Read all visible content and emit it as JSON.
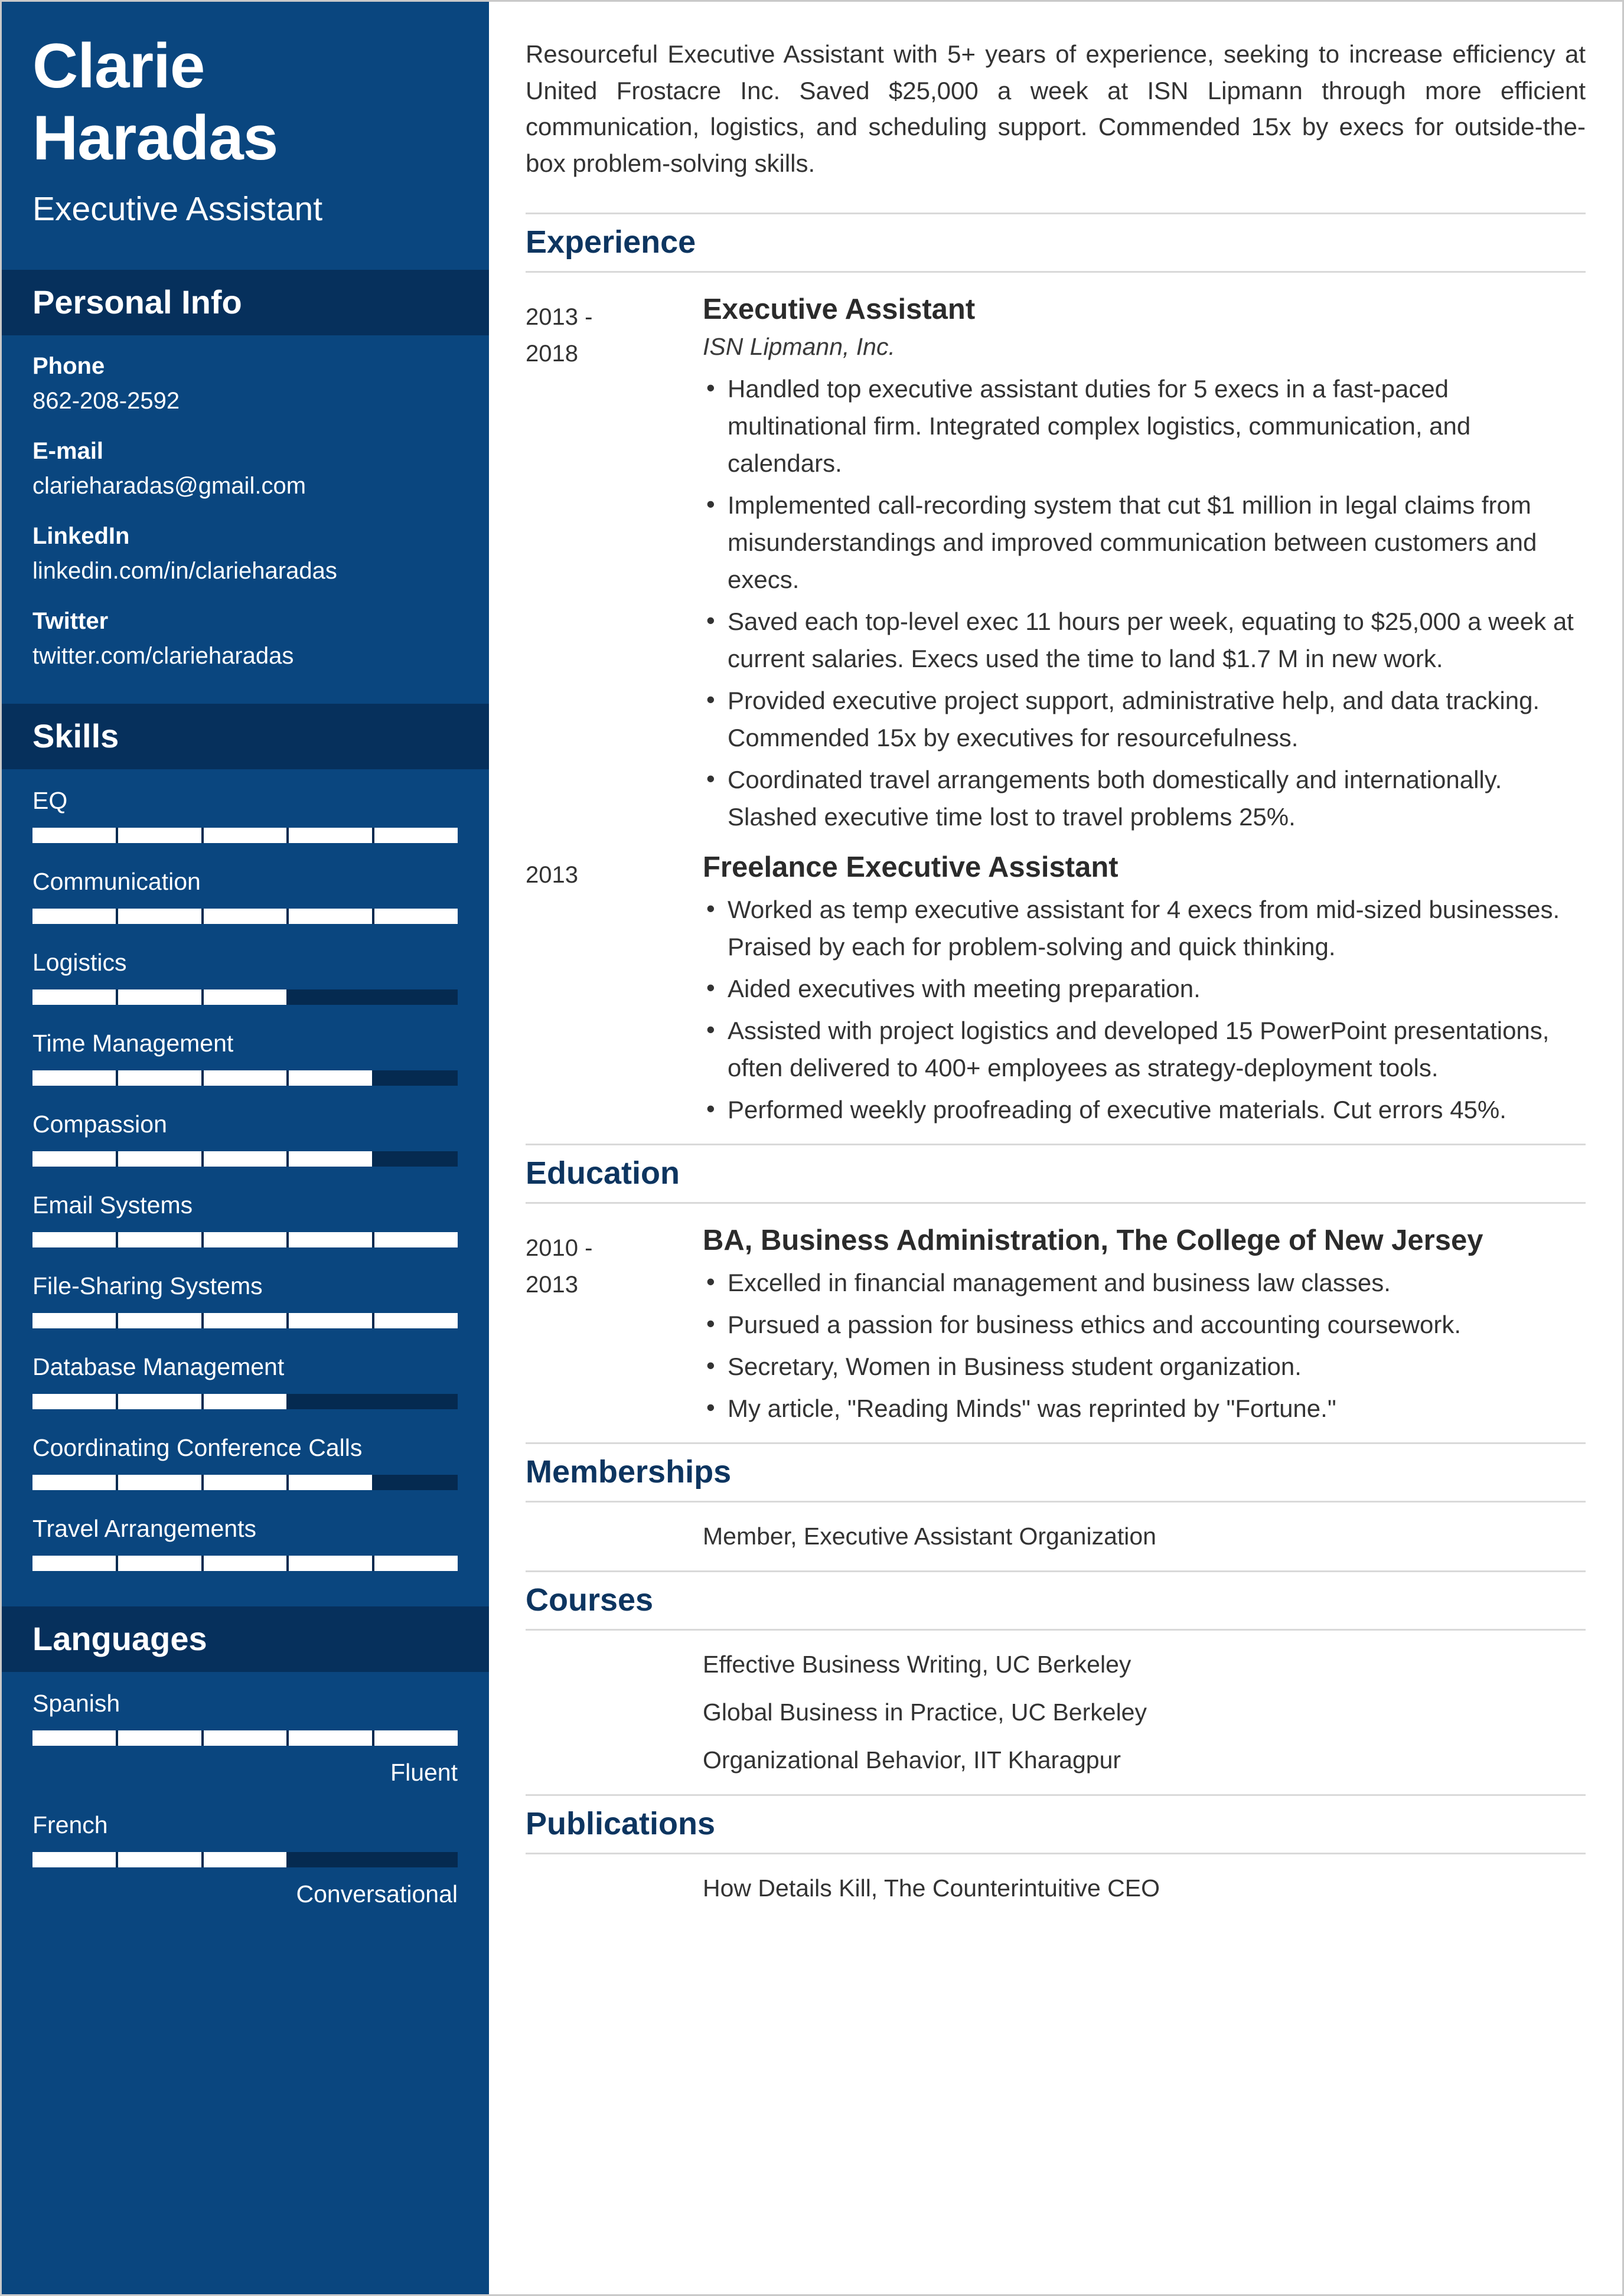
{
  "profile": {
    "first_name": "Clarie",
    "last_name": "Haradas",
    "job_title": "Executive Assistant"
  },
  "sidebar": {
    "personal_info": {
      "heading": "Personal Info",
      "fields": [
        {
          "label": "Phone",
          "value": "862-208-2592"
        },
        {
          "label": "E-mail",
          "value": "clarieharadas@gmail.com"
        },
        {
          "label": "LinkedIn",
          "value": "linkedin.com/in/clarieharadas"
        },
        {
          "label": "Twitter",
          "value": "twitter.com/clarieharadas"
        }
      ]
    },
    "skills": {
      "heading": "Skills",
      "items": [
        {
          "name": "EQ",
          "level": 100
        },
        {
          "name": "Communication",
          "level": 100
        },
        {
          "name": "Logistics",
          "level": 60
        },
        {
          "name": "Time Management",
          "level": 80
        },
        {
          "name": "Compassion",
          "level": 80
        },
        {
          "name": "Email Systems",
          "level": 100
        },
        {
          "name": "File-Sharing Systems",
          "level": 100
        },
        {
          "name": "Database Management",
          "level": 60
        },
        {
          "name": "Coordinating Conference Calls",
          "level": 80
        },
        {
          "name": "Travel Arrangements",
          "level": 100
        }
      ]
    },
    "languages": {
      "heading": "Languages",
      "items": [
        {
          "name": "Spanish",
          "level": 100,
          "proficiency": "Fluent"
        },
        {
          "name": "French",
          "level": 60,
          "proficiency": "Conversational"
        }
      ]
    }
  },
  "main": {
    "summary": "Resourceful Executive Assistant with 5+ years of experience, seeking to increase efficiency at United Frostacre Inc. Saved $25,000 a week at ISN Lipmann through more efficient communication, logistics, and scheduling support. Commended 15x by execs for outside-the-box problem-solving skills.",
    "experience": {
      "heading": "Experience",
      "entries": [
        {
          "date_start": "2013 -",
          "date_end": "2018",
          "title": "Executive Assistant",
          "org": "ISN Lipmann, Inc.",
          "bullets": [
            "Handled top executive assistant duties for 5 execs in a fast-paced multinational firm. Integrated complex logistics, communication, and calendars.",
            "Implemented call-recording system that cut $1 million in legal claims from misunderstandings and improved communication between customers and execs.",
            "Saved each top-level exec 11 hours per week, equating to $25,000 a week at current salaries. Execs used the time to land $1.7 M in new work.",
            "Provided executive project support, administrative help, and data tracking. Commended 15x by executives for resourcefulness.",
            "Coordinated travel arrangements both domestically and internationally. Slashed executive time lost to travel problems 25%."
          ]
        },
        {
          "date_start": "2013",
          "date_end": "",
          "title": "Freelance Executive Assistant",
          "org": "",
          "bullets": [
            "Worked as temp executive assistant for 4 execs from mid-sized businesses. Praised by each for problem-solving and quick thinking.",
            "Aided executives with meeting preparation.",
            "Assisted with project logistics and developed 15 PowerPoint presentations, often delivered to 400+ employees as strategy-deployment tools.",
            "Performed weekly proofreading of executive materials. Cut errors 45%."
          ]
        }
      ]
    },
    "education": {
      "heading": "Education",
      "entries": [
        {
          "date_start": "2010 -",
          "date_end": "2013",
          "title": "BA, Business Administration, The College of New Jersey",
          "org": "",
          "bullets": [
            "Excelled in financial management and business law classes.",
            "Pursued a passion for business ethics and accounting coursework.",
            "Secretary, Women in Business student organization.",
            "My article, \"Reading Minds\" was reprinted by \"Fortune.\""
          ]
        }
      ]
    },
    "memberships": {
      "heading": "Memberships",
      "items": [
        "Member, Executive Assistant Organization"
      ]
    },
    "courses": {
      "heading": "Courses",
      "items": [
        "Effective Business Writing, UC Berkeley",
        "Global Business in Practice, UC Berkeley",
        "Organizational Behavior, IIT Kharagpur"
      ]
    },
    "publications": {
      "heading": "Publications",
      "items": [
        "How Details Kill, The Counterintuitive CEO"
      ]
    }
  },
  "theme": {
    "sidebar_bg": "#0a467f",
    "sidebar_head_bg": "#06305c",
    "accent": "#0d3560",
    "bar_empty": "#052a50",
    "bar_fill": "#ffffff",
    "rule": "#d9d9d9"
  }
}
